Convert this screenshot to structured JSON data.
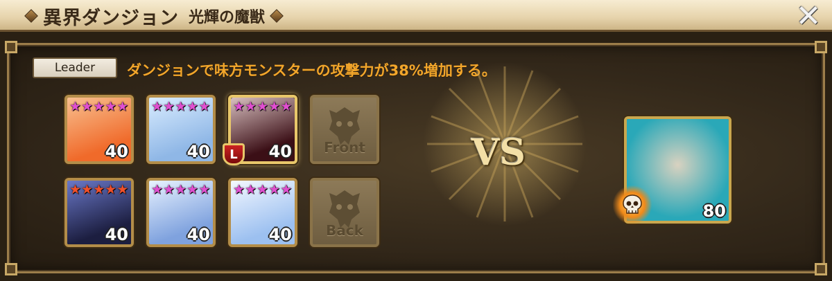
{
  "title": {
    "main": "異界ダンジョン",
    "sub": "光輝の魔獣"
  },
  "close_label": "X",
  "leader": {
    "tag": "Leader",
    "skill_text": "ダンジョンで味方モンスターの攻撃力が38%増加する。"
  },
  "team": {
    "front": [
      {
        "level": "40",
        "stars": 5,
        "star_color": "#e04fd0",
        "bg": [
          "#f06a2a",
          "#f8c090"
        ],
        "leader": false
      },
      {
        "level": "40",
        "stars": 5,
        "star_color": "#e04fd0",
        "bg": [
          "#8fb7e6",
          "#d9ecff"
        ],
        "leader": false
      },
      {
        "level": "40",
        "stars": 5,
        "star_color": "#e04fd0",
        "bg": [
          "#3b0f16",
          "#d8c0c0"
        ],
        "leader": true,
        "leader_badge": "L"
      }
    ],
    "back": [
      {
        "level": "40",
        "stars": 5,
        "star_color": "#f0502a",
        "bg": [
          "#1c1e40",
          "#6a78c8"
        ],
        "leader": false
      },
      {
        "level": "40",
        "stars": 5,
        "star_color": "#e04fd0",
        "bg": [
          "#7fa2de",
          "#e8f2ff"
        ],
        "leader": false
      },
      {
        "level": "40",
        "stars": 5,
        "star_color": "#e04fd0",
        "bg": [
          "#9cc0f0",
          "#f4f8ff"
        ],
        "leader": false
      }
    ],
    "front_slot_label": "Front",
    "back_slot_label": "Back"
  },
  "vs_label": "VS",
  "boss": {
    "level": "80",
    "bg": [
      "#2aa8b8",
      "#d9d2c0"
    ]
  },
  "colors": {
    "accent_text": "#f2a62b",
    "frame": "#b38d49"
  }
}
